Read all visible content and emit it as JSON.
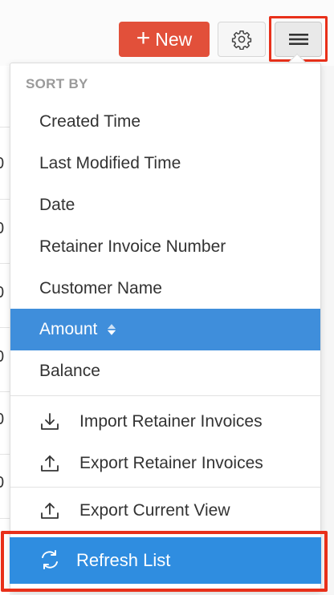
{
  "toolbar": {
    "new_label": "New",
    "new_icon": "plus-icon",
    "settings_icon": "gear-icon",
    "menu_icon": "hamburger-icon",
    "accent_color": "#e2503a"
  },
  "dropdown": {
    "section_title": "SORT BY",
    "sort_items": [
      {
        "label": "Created Time"
      },
      {
        "label": "Last Modified Time"
      },
      {
        "label": "Date"
      },
      {
        "label": "Retainer Invoice Number"
      },
      {
        "label": "Customer Name"
      },
      {
        "label": "Amount",
        "selected": true
      },
      {
        "label": "Balance"
      }
    ],
    "actions": [
      {
        "label": "Import Retainer Invoices",
        "icon": "import-icon"
      },
      {
        "label": "Export Retainer Invoices",
        "icon": "export-icon"
      },
      {
        "label": "Export Current View",
        "icon": "export-icon"
      }
    ],
    "refresh": {
      "label": "Refresh List",
      "icon": "refresh-icon"
    },
    "selected_color": "#3f8edb",
    "highlight_color": "#e8301a"
  },
  "background": {
    "row_digits": [
      "0",
      "0",
      "0",
      "0",
      "0",
      "0",
      "0"
    ]
  }
}
